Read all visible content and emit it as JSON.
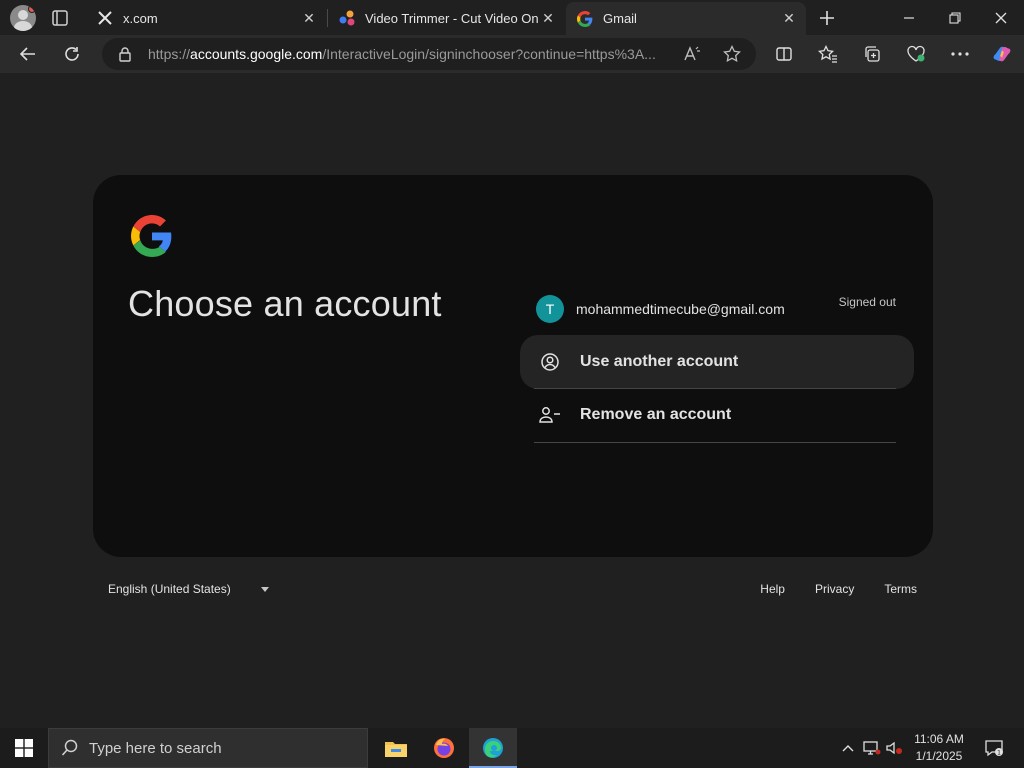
{
  "browser": {
    "tabs": [
      {
        "title": "x.com",
        "favicon": "x-logo-icon"
      },
      {
        "title": "Video Trimmer - Cut Video Online",
        "favicon": "video-trimmer-icon"
      },
      {
        "title": "Gmail",
        "favicon": "google-g-icon",
        "active": true
      }
    ],
    "url": {
      "prefix": "https://",
      "host": "accounts.google.com",
      "path": "/InteractiveLogin/signinchooser?continue=https%3A..."
    }
  },
  "page": {
    "heading": "Choose an account",
    "account": {
      "initial": "T",
      "email": "mohammedtimecube@gmail.com",
      "status": "Signed out",
      "avatar_color": "#12939a"
    },
    "options": [
      {
        "label": "Use another account",
        "icon": "account-circle-icon"
      },
      {
        "label": "Remove an account",
        "icon": "person-remove-icon"
      }
    ]
  },
  "footer": {
    "language": "English (United States)",
    "links": [
      "Help",
      "Privacy",
      "Terms"
    ]
  },
  "taskbar": {
    "search_placeholder": "Type here to search",
    "time": "11:06 AM",
    "date": "1/1/2025"
  },
  "colors": {
    "background": "#202020",
    "card": "#0e0e0e",
    "accent": "#7aa6e8"
  }
}
